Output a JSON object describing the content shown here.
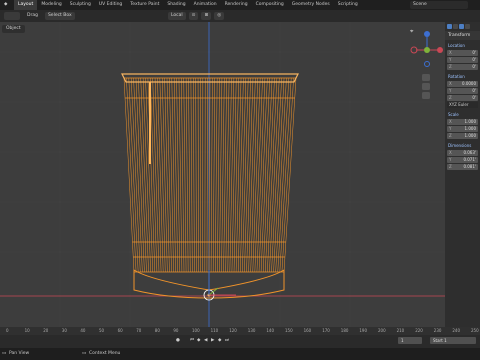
{
  "topbar": {
    "tabs": [
      "Layout",
      "Modeling",
      "Sculpting",
      "UV Editing",
      "Texture Paint",
      "Shading",
      "Animation",
      "Rendering",
      "Compositing",
      "Geometry Nodes",
      "Scripting"
    ],
    "active_tab": "Layout",
    "scene": "Scene"
  },
  "toolbar": {
    "mode": "",
    "drag_label": "Drag",
    "select_box": "Select Box",
    "orientation": "Local"
  },
  "viewport": {
    "object_button": "Object"
  },
  "npanel": {
    "header": "Transform",
    "location": {
      "label": "Location",
      "x": "0'",
      "y": "0'",
      "z": "0'"
    },
    "rotation": {
      "label": "Rotation",
      "x": "0.0000",
      "y": "0'",
      "z": "0'",
      "mode": "XYZ Euler"
    },
    "scale": {
      "label": "Scale",
      "x": "1.000",
      "y": "1.000",
      "z": "1.000"
    },
    "dimensions": {
      "label": "Dimensions",
      "x": "0.063'",
      "y": "0.071'",
      "z": "0.081'"
    }
  },
  "timeline": {
    "ticks": [
      "0",
      "10",
      "20",
      "30",
      "40",
      "50",
      "60",
      "70",
      "80",
      "90",
      "100",
      "110",
      "120",
      "130",
      "140",
      "150",
      "160",
      "170",
      "180",
      "190",
      "200",
      "210",
      "220",
      "230",
      "240",
      "250"
    ],
    "current_frame": "1",
    "start_label": "Start",
    "start_value": "1"
  },
  "statusbar": {
    "left": "Pan View",
    "middle": "Context Menu"
  },
  "colors": {
    "wire": "#f0932a",
    "wire_light": "#f6b461",
    "axis_red": "#c94855",
    "axis_green": "#7fb33a",
    "axis_blue": "#3d6fd1"
  }
}
